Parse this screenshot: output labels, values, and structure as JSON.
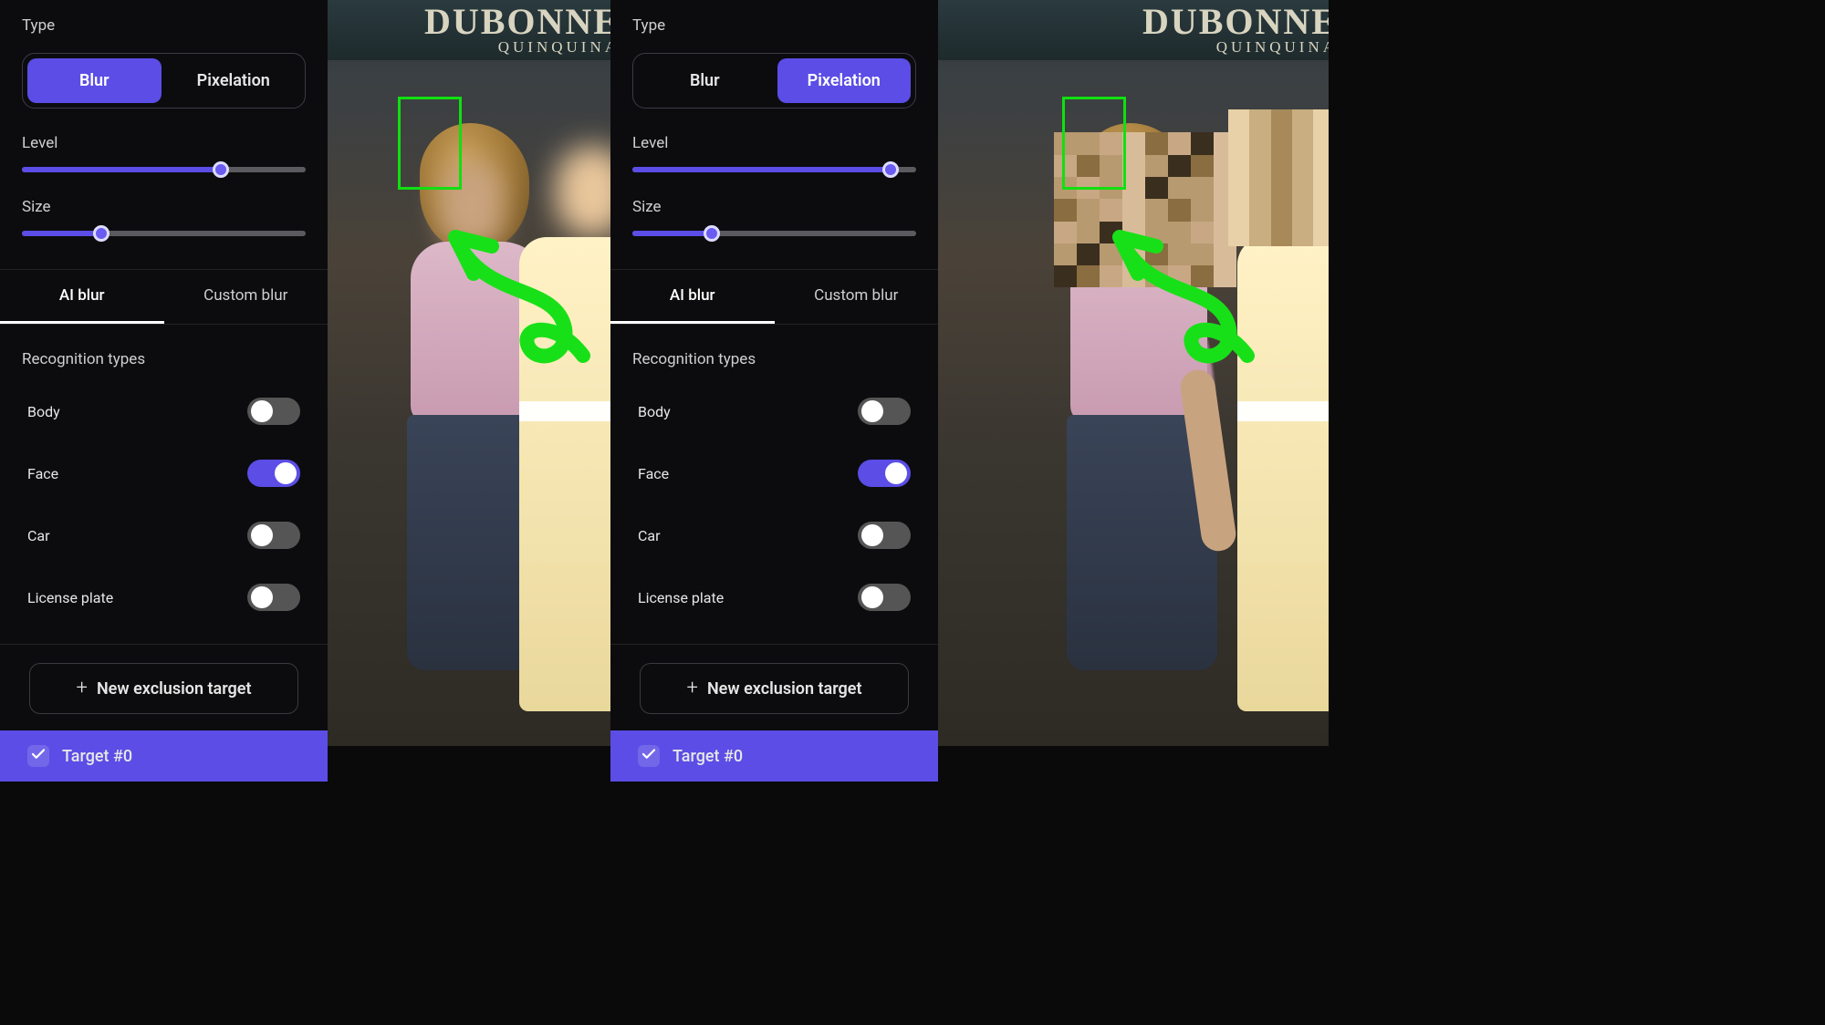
{
  "colors": {
    "accent": "#5b4de6",
    "highlight": "#10e010"
  },
  "left": {
    "typeLabel": "Type",
    "typeOptions": {
      "blur": "Blur",
      "pixelation": "Pixelation"
    },
    "activeType": "blur",
    "level": {
      "label": "Level",
      "percent": 70
    },
    "size": {
      "label": "Size",
      "percent": 28
    },
    "tabs": {
      "ai": "AI blur",
      "custom": "Custom blur",
      "active": "ai"
    },
    "recogLabel": "Recognition types",
    "toggles": [
      {
        "label": "Body",
        "on": false
      },
      {
        "label": "Face",
        "on": true
      },
      {
        "label": "Car",
        "on": false
      },
      {
        "label": "License plate",
        "on": false
      }
    ],
    "newTarget": "New exclusion target",
    "targetRow": "Target #0",
    "sign": {
      "big": "DUBONNE",
      "small": "QUINQUINA"
    }
  },
  "right": {
    "typeLabel": "Type",
    "typeOptions": {
      "blur": "Blur",
      "pixelation": "Pixelation"
    },
    "activeType": "pixelation",
    "level": {
      "label": "Level",
      "percent": 91
    },
    "size": {
      "label": "Size",
      "percent": 28
    },
    "tabs": {
      "ai": "AI blur",
      "custom": "Custom blur",
      "active": "ai"
    },
    "recogLabel": "Recognition types",
    "toggles": [
      {
        "label": "Body",
        "on": false
      },
      {
        "label": "Face",
        "on": true
      },
      {
        "label": "Car",
        "on": false
      },
      {
        "label": "License plate",
        "on": false
      }
    ],
    "newTarget": "New exclusion target",
    "targetRow": "Target #0",
    "sign": {
      "big": "DUBONNE",
      "small": "QUINQUINA"
    }
  }
}
